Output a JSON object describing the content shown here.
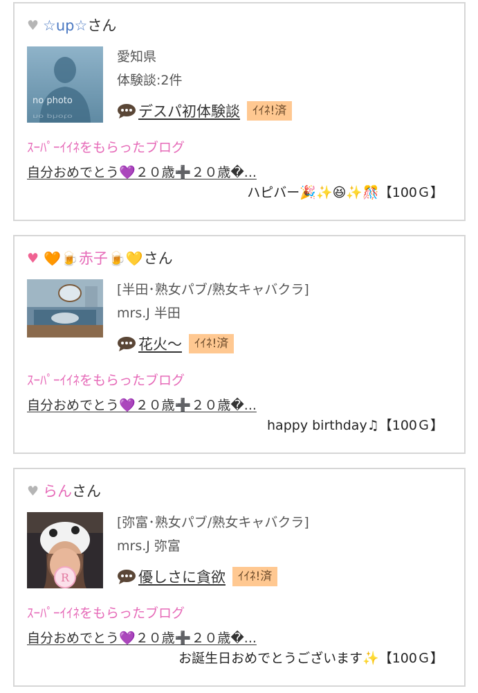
{
  "colors": {
    "pink": "#e66ab8",
    "blue": "#4a78c2",
    "badge_bg": "#ffc891",
    "border": "#d6d6d6"
  },
  "cards": [
    {
      "heart_icon": "gray-heart-icon",
      "name_prefix_emoji": "",
      "name": "☆up☆",
      "name_suffix_emoji": "",
      "name_color": "#4a78c2",
      "san": "さん",
      "avatar_label": "no photo",
      "info_1": "愛知県",
      "info_2": "体験談:2件",
      "diary_title": "デスパ初体験談",
      "iine_label": "ｲｲﾈ!済",
      "super_label": "ｽｰﾊﾟｰｲｲﾈをもらったブログ",
      "blog_title": "自分おめでとう💜２０歳➕２０歳�...",
      "comment": "ハピバー🎉✨😆✨🎊【100Ｇ】"
    },
    {
      "heart_icon": "pink-heart-icon",
      "name_prefix_emoji": "🧡🍺",
      "name": "赤子",
      "name_suffix_emoji": "🍺💛",
      "name_color": "#e66ab8",
      "san": "さん",
      "avatar_label": "",
      "info_1": "[半田･熟女パブ/熟女キャバクラ]",
      "info_2": "mrs.J 半田",
      "diary_title": "花火〜",
      "iine_label": "ｲｲﾈ!済",
      "super_label": "ｽｰﾊﾟｰｲｲﾈをもらったブログ",
      "blog_title": "自分おめでとう💜２０歳➕２０歳�...",
      "comment": "happy birthday♫【100Ｇ】"
    },
    {
      "heart_icon": "gray-heart-icon",
      "name_prefix_emoji": "",
      "name": "らん",
      "name_suffix_emoji": "",
      "name_color": "#e66ab8",
      "san": "さん",
      "avatar_label": "R",
      "info_1": "[弥富･熟女パブ/熟女キャバクラ]",
      "info_2": "mrs.J 弥富",
      "diary_title": "優しさに貪欲",
      "iine_label": "ｲｲﾈ!済",
      "super_label": "ｽｰﾊﾟｰｲｲﾈをもらったブログ",
      "blog_title": "自分おめでとう💜２０歳➕２０歳�...",
      "comment": "お誕生日おめでとうございます✨【100Ｇ】"
    }
  ]
}
